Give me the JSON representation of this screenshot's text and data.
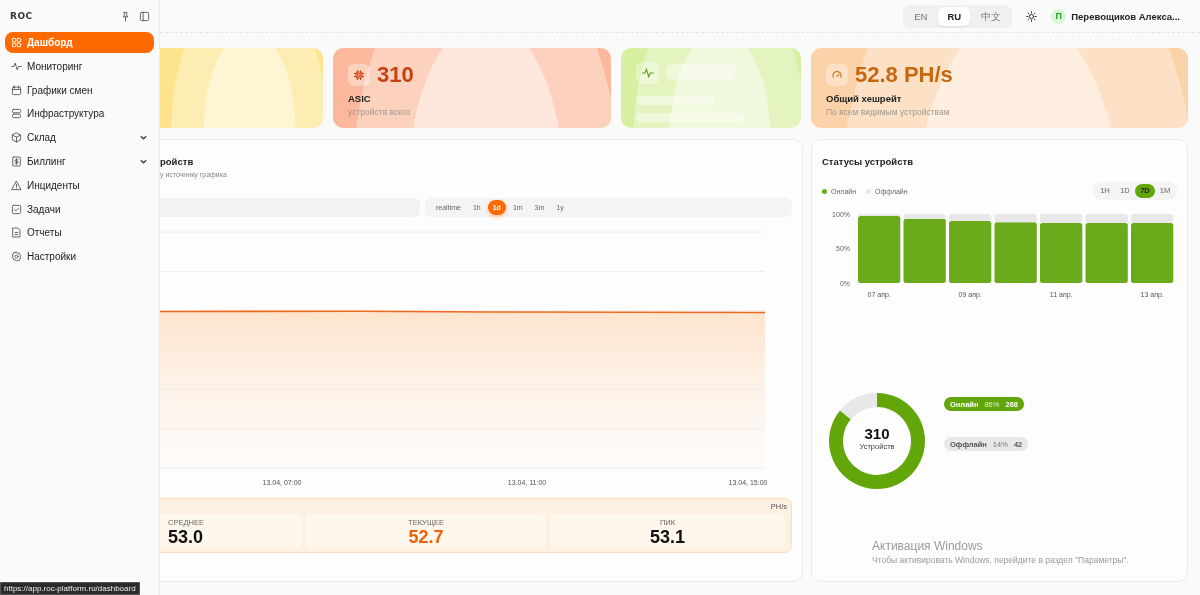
{
  "sidebar": {
    "logo": "ROC",
    "items": [
      {
        "kind": "link",
        "label": "Дашборд",
        "selected": true
      },
      {
        "kind": "link",
        "label": "Мониторинг",
        "selected": false
      },
      {
        "kind": "link",
        "label": "Графики смен",
        "selected": false
      },
      {
        "kind": "link",
        "label": "Инфраструктура",
        "selected": false
      },
      {
        "kind": "group",
        "label": "Склад",
        "selected": false,
        "expanded": false
      },
      {
        "kind": "group",
        "label": "Биллинг",
        "selected": false,
        "expanded": false
      },
      {
        "kind": "link",
        "label": "Инциденты",
        "selected": false
      },
      {
        "kind": "link",
        "label": "Задачи",
        "selected": false
      },
      {
        "kind": "link",
        "label": "Отчеты",
        "selected": false
      },
      {
        "kind": "link",
        "label": "Настройки",
        "selected": false
      }
    ]
  },
  "header": {
    "languages": [
      {
        "label": "EN",
        "selected": false
      },
      {
        "label": "RU",
        "selected": true
      },
      {
        "label": "中文",
        "selected": false
      }
    ],
    "user": {
      "initial": "П",
      "name": "Перевощиков Алекса..."
    }
  },
  "kpi_cards": [
    {
      "kind": "blank",
      "color": "#fde48a"
    },
    {
      "kind": "stat",
      "color": "#fbb89c",
      "value": "310",
      "label": "ASIC",
      "caption": "устройств всего"
    },
    {
      "kind": "skeleton",
      "color": "#d6efa0"
    },
    {
      "kind": "stat",
      "color": "#fcd2a8",
      "value": "52.8 PH/s",
      "label": "Общий хешрейт",
      "caption": "По всем видимым устройствам"
    }
  ],
  "hashrate_panel": {
    "title": "ройств",
    "subtitle": "у источнику графика",
    "ranges": [
      {
        "label": "realtime",
        "selected": false
      },
      {
        "label": "1h",
        "selected": false
      },
      {
        "label": "1d",
        "selected": true
      },
      {
        "label": "1m",
        "selected": false
      },
      {
        "label": "3m",
        "selected": false
      },
      {
        "label": "1y",
        "selected": false
      }
    ],
    "x_labels": [
      "13.04, 07:00",
      "13.04, 11:00",
      "13.04, 15:00"
    ],
    "unit": "PH/s",
    "stats": [
      {
        "label": "СРЕДНЕЕ",
        "value": "53.0",
        "highlight": false
      },
      {
        "label": "ТЕКУЩЕЕ",
        "value": "52.7",
        "highlight": true
      },
      {
        "label": "ПИК",
        "value": "53.1",
        "highlight": false
      }
    ]
  },
  "status_panel": {
    "title": "Статусы устройств",
    "ranges": [
      {
        "label": "1H",
        "selected": false
      },
      {
        "label": "1D",
        "selected": false
      },
      {
        "label": "7D",
        "selected": true
      },
      {
        "label": "1M",
        "selected": false
      }
    ],
    "chart_data": {
      "type": "bar",
      "stacked": true,
      "categories": [
        "07 апр.",
        null,
        "09 апр.",
        null,
        "11 апр.",
        null,
        "13 апр."
      ],
      "ylim": [
        0,
        100
      ],
      "yticks": [
        {
          "value": 0,
          "label": "0%"
        },
        {
          "value": 50,
          "label": "50%"
        },
        {
          "value": 100,
          "label": "100%"
        }
      ],
      "series": [
        {
          "name": "Онлайн",
          "color": "#6aab1c",
          "values": [
            97,
            93,
            90,
            88,
            87,
            87,
            87
          ]
        },
        {
          "name": "Оффлайн",
          "color": "#e8e8e8",
          "values": [
            3,
            7,
            10,
            12,
            13,
            13,
            13
          ]
        }
      ]
    },
    "donut": {
      "center_value": "310",
      "center_label": "Устройств",
      "chart_data": {
        "type": "donut",
        "categories": [
          "Онлайн",
          "Оффлайн"
        ],
        "values": [
          86,
          14
        ]
      },
      "legend": [
        {
          "percent": "86%",
          "count": "268",
          "color": "#62a60a"
        },
        {
          "percent": "14%",
          "count": "42",
          "color": "#e8e8e8"
        }
      ]
    }
  },
  "status_link": "https://app.roc-platform.ru/dashboard",
  "os_overlay": {
    "title": "Активация Windows",
    "text": "Чтобы активировать Windows, перейдите в раздел \"Параметры\"."
  }
}
